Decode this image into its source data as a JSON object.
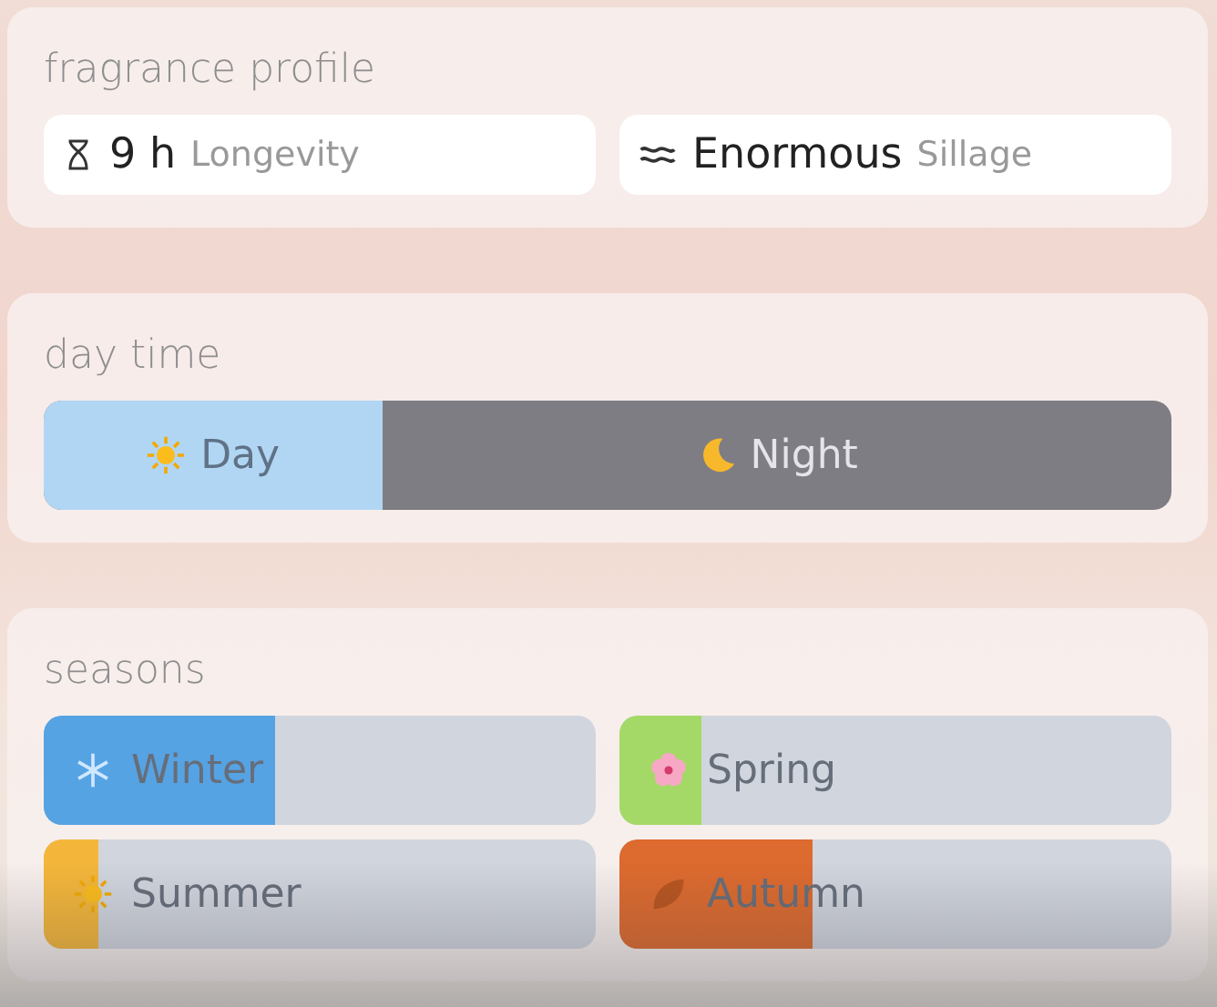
{
  "profile": {
    "title": "fragrance profile",
    "stats": [
      {
        "kind": "hourglass",
        "value": "9 h",
        "label": "Longevity"
      },
      {
        "kind": "waves",
        "value": "Enormous",
        "label": "Sillage"
      }
    ]
  },
  "day_time": {
    "title": "day time",
    "day": {
      "label": "Day",
      "level": 0.3
    },
    "night": {
      "label": "Night"
    }
  },
  "seasons": {
    "title": "seasons",
    "items": [
      {
        "kind": "snow",
        "label": "Winter",
        "level": 0.42,
        "color": "#56a3e4"
      },
      {
        "kind": "flower",
        "label": "Spring",
        "level": 0.15,
        "color": "#a4d968"
      },
      {
        "kind": "sun",
        "label": "Summer",
        "level": 0.1,
        "color": "#f4b63a"
      },
      {
        "kind": "leaf",
        "label": "Autumn",
        "level": 0.35,
        "color": "#dd6a2e"
      }
    ]
  }
}
